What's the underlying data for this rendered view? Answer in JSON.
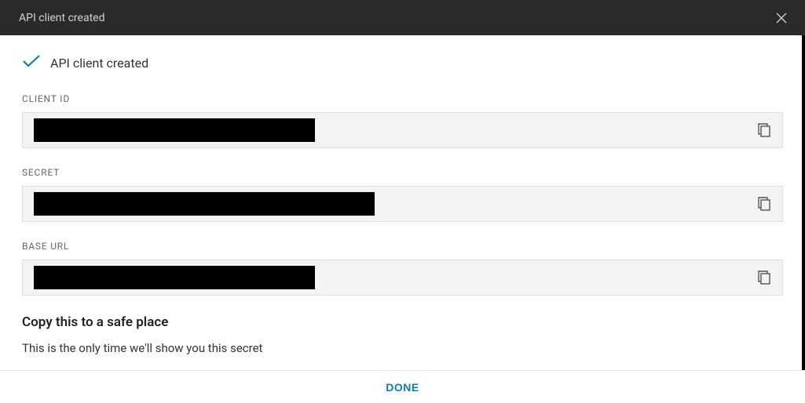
{
  "titlebar": {
    "title": "API client created"
  },
  "status": {
    "text": "API client created"
  },
  "fields": {
    "client_id": {
      "label": "CLIENT ID",
      "value_redacted": true
    },
    "secret": {
      "label": "SECRET",
      "value_redacted": true
    },
    "base_url": {
      "label": "BASE URL",
      "value_redacted": true
    }
  },
  "info": {
    "heading": "Copy this to a safe place",
    "text": "This is the only time we'll show you this secret"
  },
  "footer": {
    "done_label": "DONE"
  },
  "icons": {
    "close": "close-icon",
    "check": "check-icon",
    "copy": "copy-icon"
  }
}
